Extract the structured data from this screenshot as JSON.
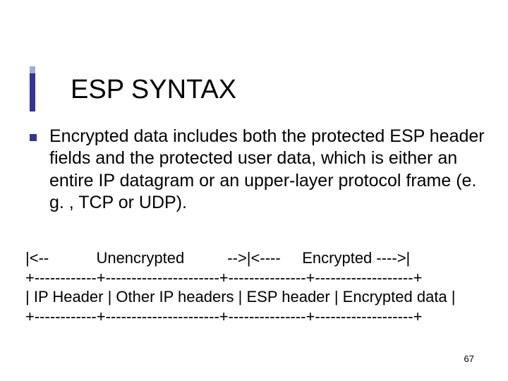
{
  "title": "ESP SYNTAX",
  "body": "Encrypted data includes both the protected ESP header fields and the protected user data, which is either an entire IP datagram or an upper-layer protocol frame (e. g. , TCP or UDP).",
  "diagram": {
    "line1": "|<--           Unencrypted          -->|<----     Encrypted ---->|",
    "line2": "+------------+----------------------+---------------+-------------------+",
    "line3": "| IP Header | Other IP headers | ESP header | Encrypted data |",
    "line4": "+------------+----------------------+---------------+-------------------+"
  },
  "page_number": "67"
}
